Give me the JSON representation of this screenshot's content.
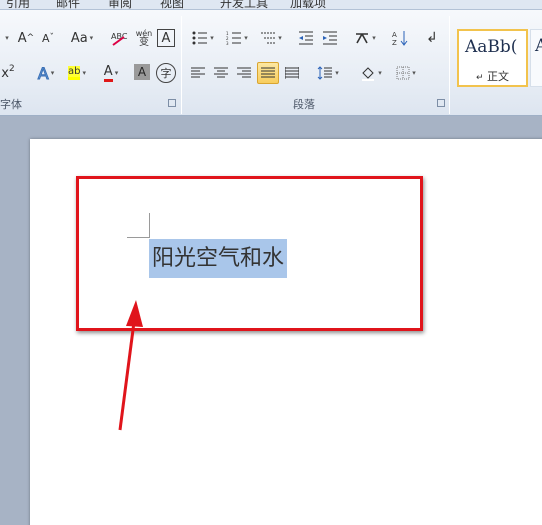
{
  "tabs": [
    "引用",
    "邮件",
    "审阅",
    "视图",
    "开发工具",
    "加载项"
  ],
  "font_group": {
    "label": "字体",
    "grow_label": "A",
    "shrink_label": "A",
    "case_label": "Aa",
    "phonetic_label": "wén",
    "phonetic_sub": "变",
    "border_char_label": "A",
    "superscript_label": "x",
    "text_effect_label": "A",
    "highlight_label": "ab",
    "font_color_label": "A",
    "char_shade_label": "A",
    "enclose_label": "字"
  },
  "paragraph_group": {
    "label": "段落"
  },
  "styles": {
    "normal_sample": "AaBb(",
    "normal_name": "正文",
    "next_sample": "A"
  },
  "document": {
    "selected_text": "阳光空气和水"
  },
  "colors": {
    "highlight": "#a9c6ea",
    "callout": "#e0141b",
    "accent": "#f2c34d"
  }
}
